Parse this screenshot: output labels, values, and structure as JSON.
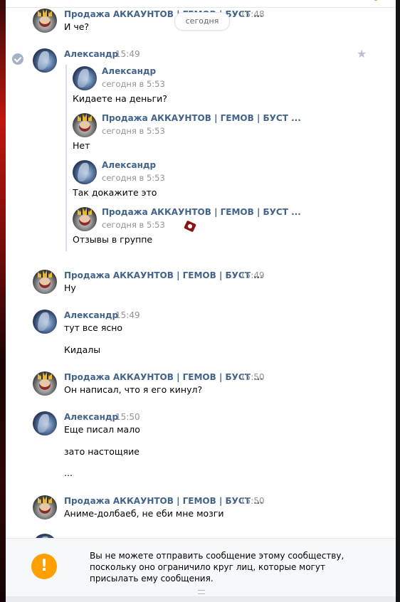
{
  "date_separator": "сегодня",
  "messages": [
    {
      "name": "Продажа АККАУНТОВ | ГЕМОВ | БУСТ ...",
      "time": "15:48",
      "lines": [
        "И че?"
      ]
    },
    {
      "name": "Александр",
      "time": "15:49",
      "lines": []
    },
    {
      "name": "Продажа АККАУНТОВ | ГЕМОВ | БУСТ ...",
      "time": "15:49",
      "lines": [
        "Ну"
      ]
    },
    {
      "name": "Александр",
      "time": "15:49",
      "lines": [
        "тут все ясно",
        "Кидалы"
      ]
    },
    {
      "name": "Продажа АККАУНТОВ | ГЕМОВ | БУСТ ...",
      "time": "15:50",
      "lines": [
        "Он написал, что я его кинул?"
      ]
    },
    {
      "name": "Александр",
      "time": "15:50",
      "lines": [
        "Еще писал мало",
        "зато настощяие",
        "..."
      ]
    },
    {
      "name": "Продажа АККАУНТОВ | ГЕМОВ | БУСТ ...",
      "time": "15:50",
      "lines": [
        "Аниме-долбаеб, не еби мне мозги"
      ]
    }
  ],
  "forwarded": [
    {
      "name": "Александр",
      "date": "сегодня в 5:53",
      "text": "Кидаете на деньги?"
    },
    {
      "name": "Продажа АККАУНТОВ | ГЕМОВ | БУСТ ...",
      "date": "сегодня в 5:53",
      "text": "Нет"
    },
    {
      "name": "Александр",
      "date": "сегодня в 5:53",
      "text": "Так докажите это"
    },
    {
      "name": "Продажа АККАУНТОВ | ГЕМОВ | БУСТ ...",
      "date": "сегодня в 5:53",
      "text": "Отзывы в группе"
    }
  ],
  "notice": {
    "icon": "!",
    "text": "Вы не можете отправить сообщение этому сообществу, поскольку оно ограничило круг лиц, которые могут присылать ему сообщения."
  },
  "colors": {
    "name": "#42648b",
    "warning": "#ffa000"
  }
}
